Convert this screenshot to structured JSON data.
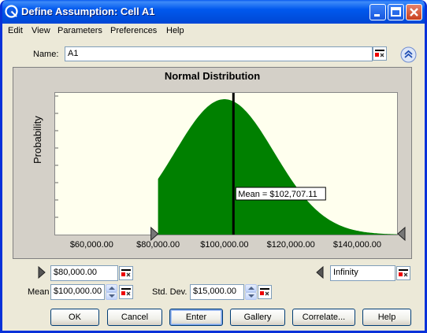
{
  "window": {
    "title": "Define Assumption: Cell A1"
  },
  "menu": [
    "Edit",
    "View",
    "Parameters",
    "Preferences",
    "Help"
  ],
  "name_field": {
    "label": "Name:",
    "value": "A1"
  },
  "chart_data": {
    "type": "area",
    "title": "Normal Distribution",
    "xlabel": "",
    "ylabel": "Probability",
    "xlim": [
      49000,
      152000
    ],
    "x_ticks": [
      "$60,000.00",
      "$80,000.00",
      "$100,000.00",
      "$120,000.00",
      "$140,000.00"
    ],
    "x_tick_values": [
      60000,
      80000,
      100000,
      120000,
      140000
    ],
    "distribution": {
      "mean": 100000,
      "std_dev": 15000
    },
    "shaded_range": [
      80000,
      152000
    ],
    "mean_marker": {
      "value": 102707.11,
      "label": "Mean = $102,707.11"
    },
    "fill_color": "#008000"
  },
  "lower_bound": {
    "value": "$80,000.00"
  },
  "upper_bound": {
    "value": "Infinity"
  },
  "mean": {
    "label": "Mean",
    "value": "$100,000.00"
  },
  "std_dev": {
    "label": "Std. Dev.",
    "value": "$15,000.00"
  },
  "buttons": {
    "ok": "OK",
    "cancel": "Cancel",
    "enter": "Enter",
    "gallery": "Gallery",
    "correlate": "Correlate...",
    "help": "Help"
  }
}
